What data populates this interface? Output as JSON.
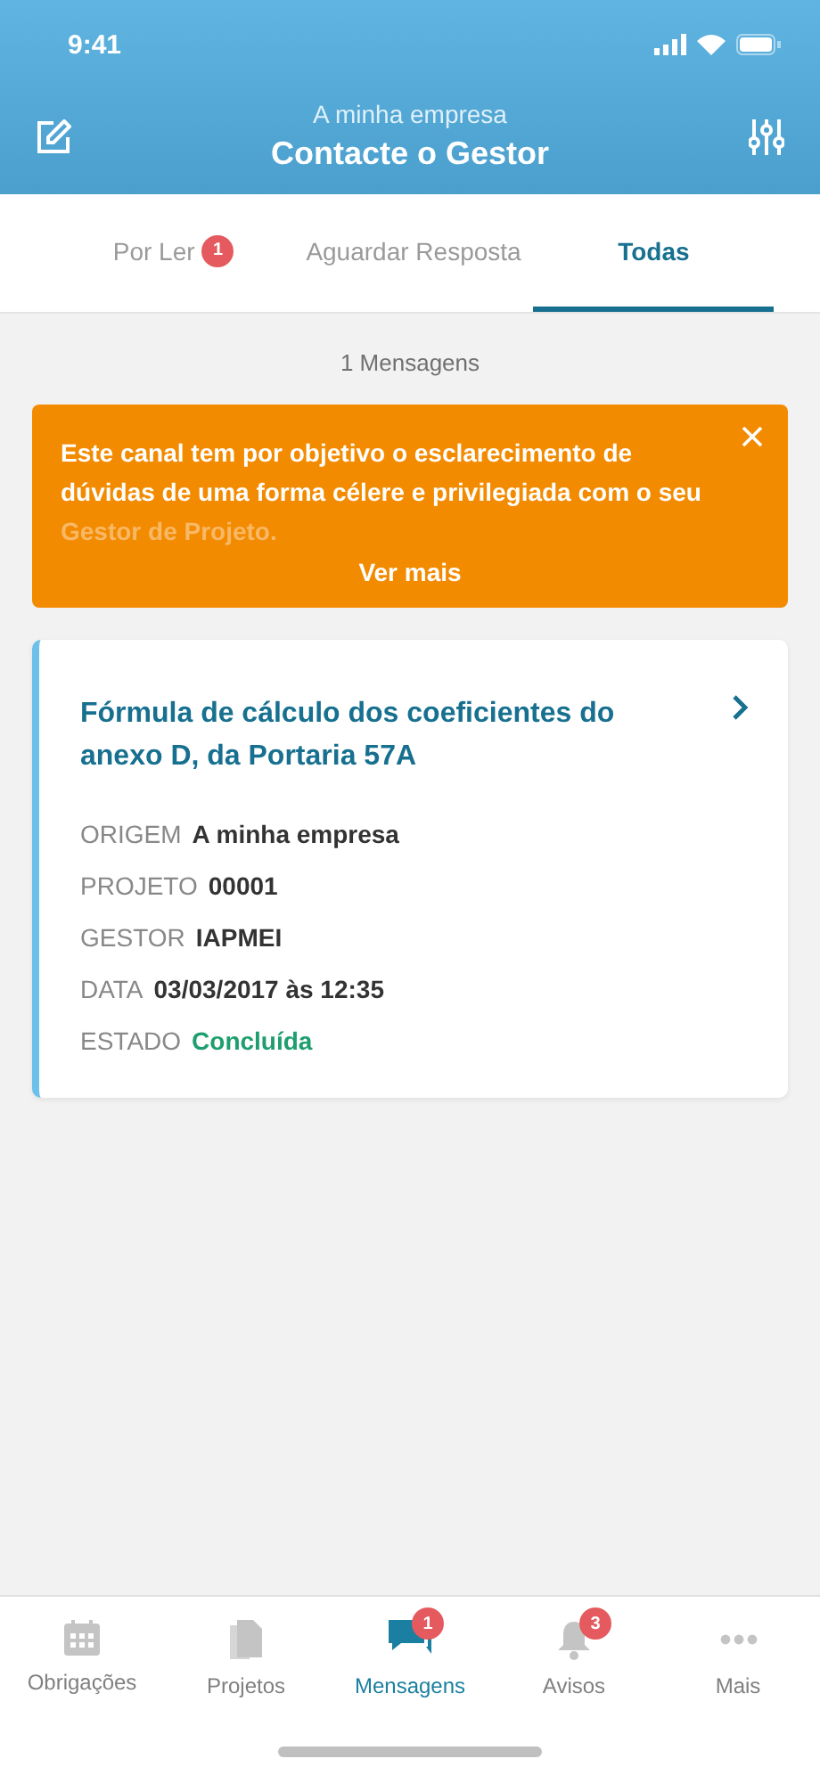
{
  "status_bar": {
    "time": "9:41"
  },
  "header": {
    "subtitle": "A minha empresa",
    "title": "Contacte o Gestor"
  },
  "tabs": [
    {
      "label": "Por Ler",
      "badge": "1",
      "selected": false
    },
    {
      "label": "Aguardar Resposta",
      "selected": false
    },
    {
      "label": "Todas",
      "selected": true
    }
  ],
  "count": "1 Mensagens",
  "banner": {
    "lines": [
      "Este canal tem por objetivo o esclarecimento de",
      "dúvidas de uma forma célere e privilegiada com o seu"
    ],
    "faded_line": "Gestor de Projeto.",
    "more": "Ver mais"
  },
  "messages": [
    {
      "title": "Fórmula de cálculo dos coeficientes do anexo D, da Portaria 57A",
      "fields": [
        {
          "label": "ORIGEM",
          "value": "A minha empresa",
          "kind": "plain"
        },
        {
          "label": "PROJETO",
          "value": "00001",
          "kind": "plain"
        },
        {
          "label": "GESTOR",
          "value": "IAPMEI",
          "kind": "plain"
        },
        {
          "label": "DATA",
          "value": "03/03/2017 às 12:35",
          "kind": "plain"
        },
        {
          "label": "ESTADO",
          "value": "Concluída",
          "kind": "status"
        }
      ]
    }
  ],
  "tab_bar": [
    {
      "label": "Obrigações",
      "kind": "calendar",
      "selected": false
    },
    {
      "label": "Projetos",
      "kind": "document",
      "selected": false
    },
    {
      "label": "Mensagens",
      "kind": "chat",
      "badge": "1",
      "selected": true
    },
    {
      "label": "Avisos",
      "kind": "bell",
      "badge": "3",
      "selected": false
    },
    {
      "label": "Mais",
      "kind": "more",
      "selected": false
    }
  ]
}
